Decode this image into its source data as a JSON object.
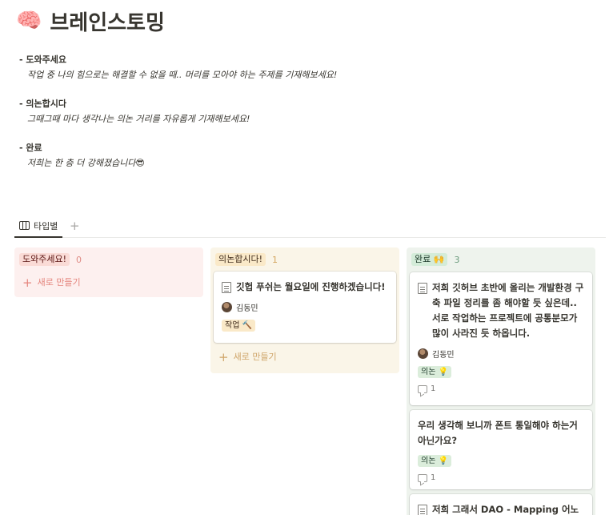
{
  "page": {
    "emoji": "🧠",
    "title": "브레인스토밍"
  },
  "sections": [
    {
      "head": "- 도와주세요",
      "desc": "작업 중 나의 힘으로는 해결할 수 없을 때.. 머리를 모아야 하는 주제를 기재해보세요!"
    },
    {
      "head": "- 의논합시다",
      "desc": "그때그때 마다 생각나는 의논 거리를 자유롭게 기재해보세요!"
    },
    {
      "head": "- 완료",
      "desc": "저희는 한 층 더 강해졌습니다😎"
    }
  ],
  "view": {
    "tab_label": "타입별",
    "add_symbol": "+"
  },
  "columns": [
    {
      "label": "도와주세요!",
      "count": "0",
      "new_label": "새로 만들기",
      "plus": "+"
    },
    {
      "label": "의논합시다!",
      "count": "1",
      "new_label": "새로 만들기",
      "plus": "+"
    },
    {
      "label": "완료 🙌",
      "count": "3"
    }
  ],
  "cards": {
    "discuss": [
      {
        "title": "깃헙 푸쉬는 월요일에 진행하겠습니다!",
        "person": "김동민",
        "tag": "작업 🔨"
      }
    ],
    "done": [
      {
        "title": "저희 깃허브 초반에 올리는 개발환경 구축 파일 정리를 좀 해야할 듯 싶은데.. 서로 작업하는 프로젝트에 공통분모가 많이 사라진 듯 하옵니다.",
        "person": "김동민",
        "tag": "의논 💡",
        "comments": "1"
      },
      {
        "title": "우리 생각해 보니까 폰트 통일해야 하는거 아닌가요?",
        "tag": "의논 💡",
        "comments": "1"
      },
      {
        "title": "저희 그래서 DAO - Mapping 어노테"
      }
    ]
  }
}
